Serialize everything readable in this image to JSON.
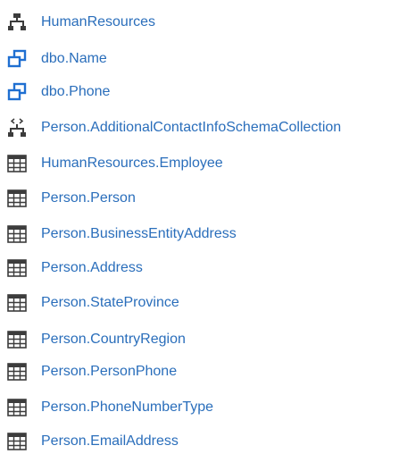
{
  "colors": {
    "link": "#2a6ebb",
    "icon_dark": "#3c3c3c",
    "icon_blue": "#1f6fd1"
  },
  "items": [
    {
      "label": "HumanResources",
      "icon": "schema-icon"
    },
    {
      "label": "dbo.Name",
      "icon": "user-defined-type-icon"
    },
    {
      "label": "dbo.Phone",
      "icon": "user-defined-type-icon"
    },
    {
      "label": "Person.AdditionalContactInfoSchemaCollection",
      "icon": "xml-schema-collection-icon"
    },
    {
      "label": "HumanResources.Employee",
      "icon": "table-icon"
    },
    {
      "label": "Person.Person",
      "icon": "table-icon"
    },
    {
      "label": "Person.BusinessEntityAddress",
      "icon": "table-icon"
    },
    {
      "label": "Person.Address",
      "icon": "table-icon"
    },
    {
      "label": "Person.StateProvince",
      "icon": "table-icon"
    },
    {
      "label": "Person.CountryRegion",
      "icon": "table-icon"
    },
    {
      "label": "Person.PersonPhone",
      "icon": "table-icon"
    },
    {
      "label": "Person.PhoneNumberType",
      "icon": "table-icon"
    },
    {
      "label": "Person.EmailAddress",
      "icon": "table-icon"
    }
  ]
}
